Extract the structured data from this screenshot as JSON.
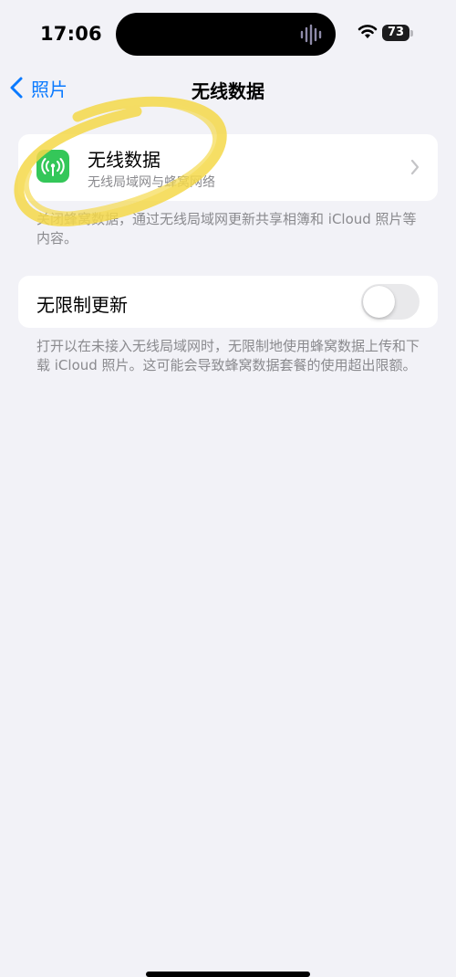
{
  "status_bar": {
    "time": "17:06",
    "battery": "73"
  },
  "nav": {
    "back_label": "照片",
    "title": "无线数据"
  },
  "wireless_row": {
    "title": "无线数据",
    "subtitle": "无线局域网与蜂窝网络"
  },
  "wireless_note": "关闭蜂窝数据，通过无线局域网更新共享相簿和 iCloud 照片等内容。",
  "unlimited_row": {
    "title": "无限制更新",
    "toggle_on": false
  },
  "unlimited_note": "打开以在未接入无线局域网时，无限制地使用蜂窝数据上传和下载 iCloud 照片。这可能会导致蜂窝数据套餐的使用超出限额。",
  "colors": {
    "accent": "#0a7aff",
    "app_icon": "#34c759",
    "highlight": "#f5d94a"
  }
}
